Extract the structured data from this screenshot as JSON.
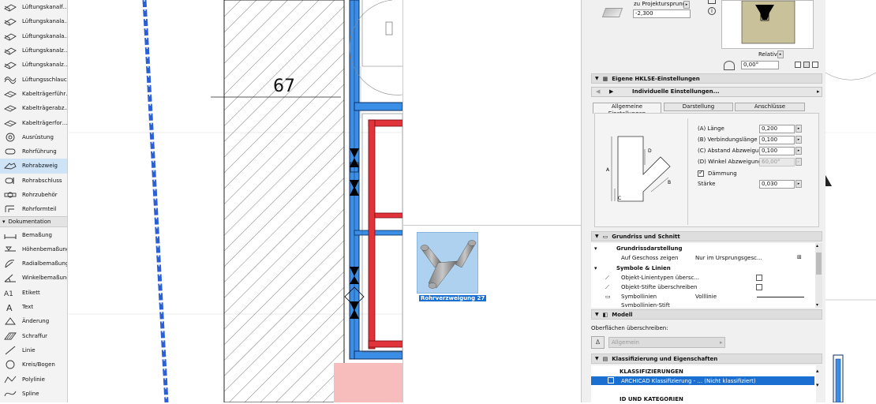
{
  "toolbox": {
    "tools": [
      {
        "label": "Lüftungskanalf…",
        "icon": "duct-icon"
      },
      {
        "label": "Lüftungskanala…",
        "icon": "duct-icon"
      },
      {
        "label": "Lüftungskanala…",
        "icon": "duct-icon"
      },
      {
        "label": "Lüftungskanalz…",
        "icon": "duct-icon"
      },
      {
        "label": "Lüftungskanalz…",
        "icon": "duct-icon"
      },
      {
        "label": "Lüftungsschlauch",
        "icon": "flex-duct-icon"
      },
      {
        "label": "Kabelträgerführ…",
        "icon": "cable-tray-icon"
      },
      {
        "label": "Kabelträgerabz…",
        "icon": "cable-tray-icon"
      },
      {
        "label": "Kabelträgerfor…",
        "icon": "cable-tray-icon"
      },
      {
        "label": "Ausrüstung",
        "icon": "equipment-icon"
      },
      {
        "label": "Rohrführung",
        "icon": "pipe-icon"
      },
      {
        "label": "Rohrabzweig",
        "icon": "pipe-branch-icon",
        "selected": true
      },
      {
        "label": "Rohrabschluss",
        "icon": "pipe-end-icon"
      },
      {
        "label": "Rohrzubehör",
        "icon": "pipe-accessory-icon"
      },
      {
        "label": "Rohrformteil",
        "icon": "pipe-fitting-icon"
      }
    ],
    "group_label": "Dokumentation",
    "doc_tools": [
      {
        "label": "Bemaßung",
        "icon": "dimension-icon"
      },
      {
        "label": "Höhenbemaßung",
        "icon": "level-dimension-icon"
      },
      {
        "label": "Radialbemaßung",
        "icon": "radial-dimension-icon"
      },
      {
        "label": "Winkelbemaßung",
        "icon": "angle-dimension-icon"
      },
      {
        "label": "Etikett",
        "icon": "label-icon"
      },
      {
        "label": "Text",
        "icon": "text-icon"
      },
      {
        "label": "Änderung",
        "icon": "change-icon"
      },
      {
        "label": "Schraffur",
        "icon": "fill-icon"
      },
      {
        "label": "Linie",
        "icon": "line-icon"
      },
      {
        "label": "Kreis/Bogen",
        "icon": "arc-icon"
      },
      {
        "label": "Polylinie",
        "icon": "polyline-icon"
      },
      {
        "label": "Spline",
        "icon": "spline-icon"
      }
    ]
  },
  "plan": {
    "dimension_text": "67"
  },
  "library": {
    "item_label": "Rohrverzweigung 27"
  },
  "settings": {
    "top": {
      "project_origin_label": "zu Projektursprung",
      "project_origin_value": "-2,300",
      "relative_label": "Relativ",
      "angle_value": "0,00°"
    },
    "hklse": {
      "header": "Eigene HKLSE-Einstellungen",
      "preset": "Individuelle Einstellungen...",
      "tabs": [
        "Allgemeine Einstellungen",
        "Darstellung",
        "Anschlüsse"
      ],
      "params": [
        {
          "label": "(A) Länge",
          "value": "0,200"
        },
        {
          "label": "(B) Verbindungslänge",
          "value": "0,100"
        },
        {
          "label": "(C) Abstand Abzweigung",
          "value": "0,100"
        },
        {
          "label": "(D) Winkel Abzweigung",
          "value": "60,00°",
          "disabled": true
        }
      ],
      "insulation_label": "Dämmung",
      "thickness_label": "Stärke",
      "thickness_value": "0,030",
      "diagram_labels": {
        "a": "A",
        "b": "B",
        "c": "C",
        "d": "D"
      }
    },
    "plan_section": {
      "header": "Grundriss und Schnitt",
      "sub1": "Grundrissdarstellung",
      "show_on_floor_label": "Auf Geschoss zeigen",
      "show_on_floor_value": "Nur im Ursprungsgesc...",
      "sub2": "Symbole & Linien",
      "override_linetypes": "Objekt-Linientypen übersc...",
      "override_pens": "Objekt-Stifte überschreiben",
      "symbol_lines": "Symbollinien",
      "symbol_lines_value": "Volllinie",
      "symbol_pen": "Symbollinien-Stift"
    },
    "model": {
      "header": "Modell",
      "override_surfaces": "Oberflächen überschreiben:",
      "surface_value": "Allgemein"
    },
    "classification": {
      "header": "Klassifizierung und Eigenschaften",
      "sub": "KLASSIFIZIERUNGEN",
      "row": "ARCHICAD Klassifizierung - ... (Nicht klassifiziert)",
      "id_header": "ID UND KATEGORIEN"
    }
  },
  "colors": {
    "accent": "#1a6fd1",
    "pipe_blue": "#3a8ee6",
    "pipe_red": "#e0343a",
    "highlight": "#cfe3f7"
  }
}
